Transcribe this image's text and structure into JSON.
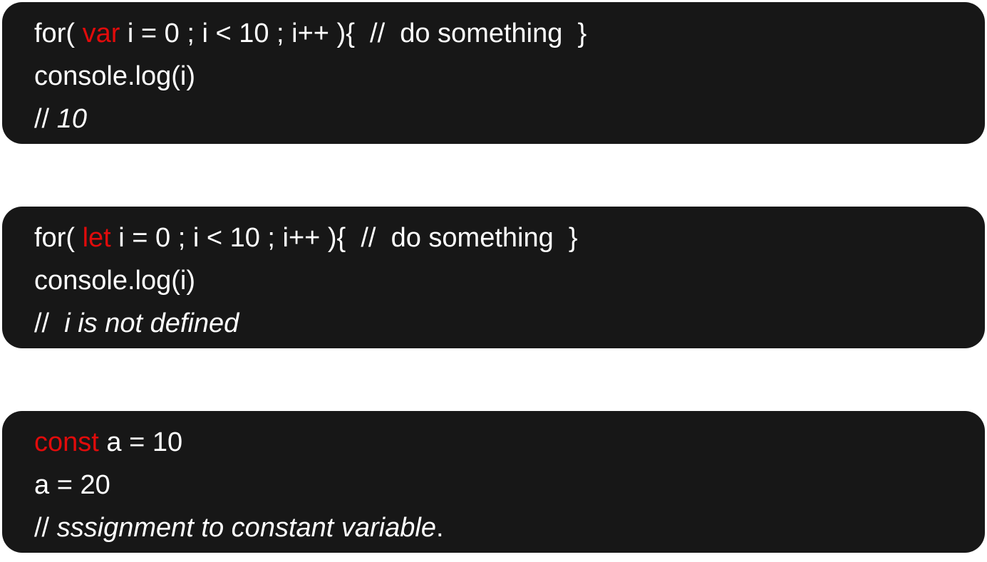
{
  "blocks": [
    {
      "line1": {
        "pre": "for( ",
        "keyword": "var",
        "post": " i = 0 ; i < 10 ; i++ ){  //  do something  }"
      },
      "line2": "console.log(i)",
      "line3": {
        "slash": "// ",
        "text": "10",
        "tail": ""
      }
    },
    {
      "line1": {
        "pre": "for( ",
        "keyword": "let",
        "post": " i = 0 ; i < 10 ; i++ ){  //  do something  }"
      },
      "line2": "console.log(i)",
      "line3": {
        "slash": "//  ",
        "text": "i is not defined",
        "tail": ""
      }
    },
    {
      "line1": {
        "pre": "",
        "keyword": "const",
        "post": " a = 10"
      },
      "line2": "a = 20",
      "line3": {
        "slash": "// ",
        "text": "sssignment to constant variable",
        "tail": "."
      }
    }
  ],
  "colors": {
    "background": "#171717",
    "text": "#ffffff",
    "keyword": "#e10b0b"
  }
}
